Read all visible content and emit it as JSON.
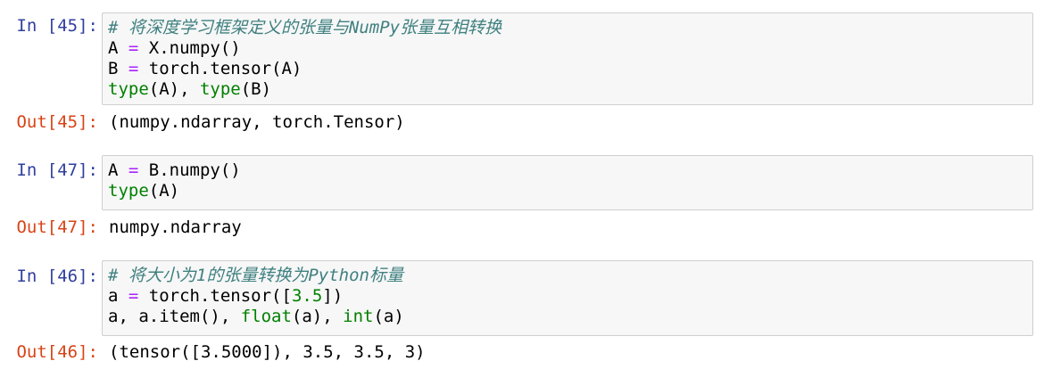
{
  "cells": [
    {
      "in_prompt": "In [45]:",
      "lines": [
        [
          [
            "comment",
            "# 将深度学习框架定义的张量与NumPy张量互相转换"
          ]
        ],
        [
          [
            "plain",
            "A "
          ],
          [
            "op",
            "="
          ],
          [
            "plain",
            " X.numpy()"
          ]
        ],
        [
          [
            "plain",
            "B "
          ],
          [
            "op",
            "="
          ],
          [
            "plain",
            " torch.tensor(A)"
          ]
        ],
        [
          [
            "builtin",
            "type"
          ],
          [
            "plain",
            "(A), "
          ],
          [
            "builtin",
            "type"
          ],
          [
            "plain",
            "(B)"
          ]
        ]
      ],
      "out_prompt": "Out[45]:",
      "output": "(numpy.ndarray, torch.Tensor)"
    },
    {
      "in_prompt": "In [47]:",
      "lines": [
        [
          [
            "plain",
            "A "
          ],
          [
            "op",
            "="
          ],
          [
            "plain",
            " B.numpy()"
          ]
        ],
        [
          [
            "builtin",
            "type"
          ],
          [
            "plain",
            "(A)"
          ]
        ]
      ],
      "out_prompt": "Out[47]:",
      "output": "numpy.ndarray"
    },
    {
      "in_prompt": "In [46]:",
      "lines": [
        [
          [
            "comment",
            "# 将大小为1的张量转换为Python标量"
          ]
        ],
        [
          [
            "plain",
            "a "
          ],
          [
            "op",
            "="
          ],
          [
            "plain",
            " torch.tensor(["
          ],
          [
            "num",
            "3.5"
          ],
          [
            "plain",
            "])"
          ]
        ],
        [
          [
            "plain",
            "a, a.item(), "
          ],
          [
            "builtin",
            "float"
          ],
          [
            "plain",
            "(a), "
          ],
          [
            "builtin",
            "int"
          ],
          [
            "plain",
            "(a)"
          ]
        ]
      ],
      "out_prompt": "Out[46]:",
      "output": "(tensor([3.5000]), 3.5, 3.5, 3)"
    }
  ],
  "colors": {
    "in_prompt": "#303f9f",
    "out_prompt": "#d84315",
    "comment": "#408080",
    "operator": "#aa22ff",
    "builtin": "#008000",
    "input_bg": "#f7f7f7",
    "input_border": "#cfcfcf"
  }
}
